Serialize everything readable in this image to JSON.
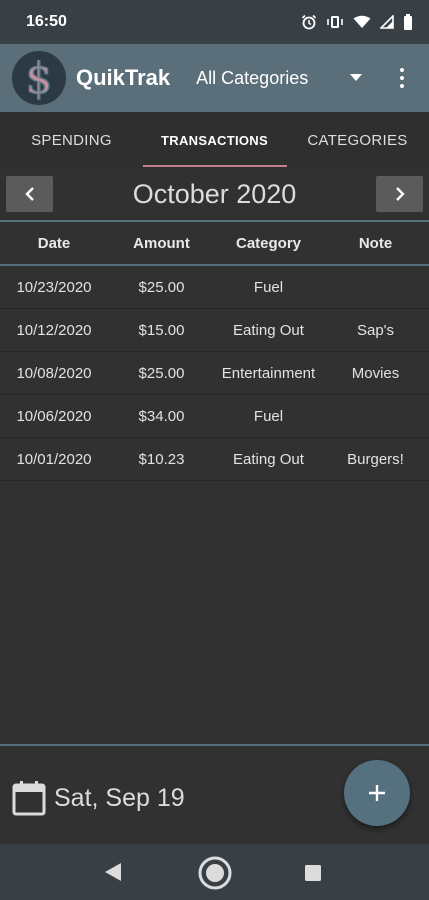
{
  "status_bar": {
    "time": "16:50",
    "icons": [
      "alarm-icon",
      "vibrate-icon",
      "wifi-icon",
      "signal-icon",
      "battery-icon"
    ]
  },
  "app_bar": {
    "logo_symbol": "$",
    "title": "QuikTrak",
    "category_selected": "All Categories",
    "icons": [
      "dollar-logo-icon",
      "dropdown-arrow-icon",
      "overflow-menu-icon"
    ]
  },
  "tabs": [
    {
      "label": "SPENDING",
      "active": false
    },
    {
      "label": "TRANSACTIONS",
      "active": true
    },
    {
      "label": "CATEGORIES",
      "active": false
    }
  ],
  "month_nav": {
    "title": "October 2020",
    "prev_icon": "chevron-left-icon",
    "next_icon": "chevron-right-icon"
  },
  "table": {
    "headers": [
      "Date",
      "Amount",
      "Category",
      "Note"
    ],
    "rows": [
      {
        "date": "10/23/2020",
        "amount": "$25.00",
        "category": "Fuel",
        "note": ""
      },
      {
        "date": "10/12/2020",
        "amount": "$15.00",
        "category": "Eating Out",
        "note": "Sap's"
      },
      {
        "date": "10/08/2020",
        "amount": "$25.00",
        "category": "Entertainment",
        "note": "Movies"
      },
      {
        "date": "10/06/2020",
        "amount": "$34.00",
        "category": "Fuel",
        "note": ""
      },
      {
        "date": "10/01/2020",
        "amount": "$10.23",
        "category": "Eating Out",
        "note": "Burgers!"
      }
    ]
  },
  "footer": {
    "date": "Sat, Sep 19",
    "calendar_icon": "calendar-icon",
    "fab_icon": "plus-icon"
  },
  "nav_bar": {
    "icons": [
      "back-icon",
      "home-icon",
      "recents-icon"
    ]
  },
  "colors": {
    "accent": "#c47f8e",
    "app_bar": "#5b6f7b",
    "background": "#313131",
    "fab": "#55707f"
  }
}
